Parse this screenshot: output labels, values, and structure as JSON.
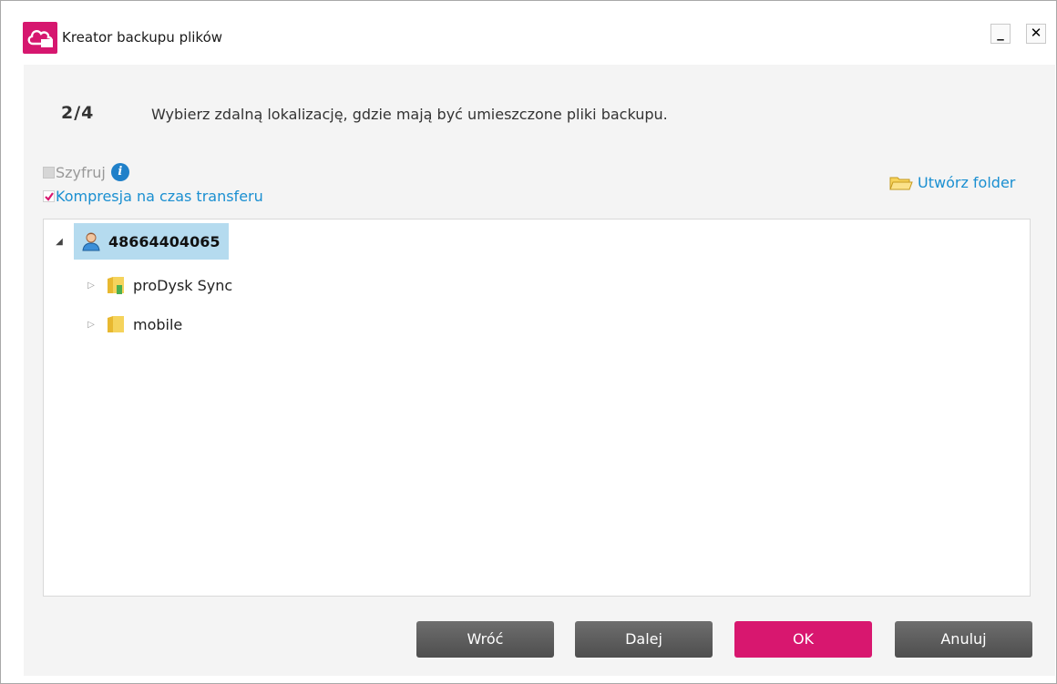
{
  "window": {
    "title": "Kreator backupu plików",
    "minimize_label": "_",
    "close_label": "✕"
  },
  "step": {
    "number": "2/4",
    "description": "Wybierz zdalną lokalizację, gdzie mają być umieszczone pliki backupu."
  },
  "options": {
    "encrypt": {
      "label": "Szyfruj",
      "checked": false,
      "enabled": false
    },
    "compress": {
      "label": "Kompresja na czas transferu",
      "checked": true,
      "enabled": true
    },
    "info_icon_label": "i"
  },
  "create_folder_label": "Utwórz folder",
  "tree": {
    "root": {
      "label": "48664404065",
      "expanded": true,
      "selected": true
    },
    "children": [
      {
        "label": "proDysk Sync",
        "expanded": false
      },
      {
        "label": "mobile",
        "expanded": false
      }
    ]
  },
  "buttons": {
    "back": "Wróć",
    "next": "Dalej",
    "ok": "OK",
    "cancel": "Anuluj"
  },
  "colors": {
    "accent": "#d8176f",
    "link": "#1a8fd1",
    "selection": "#b5dbef"
  }
}
